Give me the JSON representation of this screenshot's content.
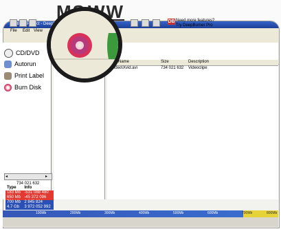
{
  "header": {
    "word_left": "MS",
    "word_right": "WW"
  },
  "window": {
    "title": "Untitled Project - DeepBurner",
    "menu": [
      "File",
      "Edit",
      "View"
    ]
  },
  "promo": {
    "line1": "Need more features?",
    "line2": "Try DeepBurner Pro"
  },
  "nav": {
    "items": [
      {
        "label": "CD/DVD",
        "icon": "disc-icon"
      },
      {
        "label": "Autorun",
        "icon": "calendar-icon"
      },
      {
        "label": "Print Label",
        "icon": "printer-icon"
      },
      {
        "label": "Burn Disk",
        "icon": "burn-disk-icon"
      }
    ]
  },
  "info": {
    "total_size": "734 021 632",
    "headers": [
      "Type",
      "Info"
    ],
    "rows": [
      {
        "type": "183 Mb",
        "info": "-531 088 480",
        "color": "#e23a30"
      },
      {
        "type": "650 Mb",
        "info": "-45 372 096",
        "color": "#e23a30"
      },
      {
        "type": "700 Mb",
        "info": "2 845 824",
        "color": "#2a4fb5"
      },
      {
        "type": "4.7 Gb",
        "info": "3 972 052 992",
        "color": "#2a4fb5"
      }
    ]
  },
  "list": {
    "columns": [
      "Name",
      "Size",
      "Description"
    ],
    "rows": [
      {
        "name": "Video\\Xvid.avi",
        "size": "734 021 632",
        "description": "Videoclipe"
      }
    ]
  },
  "capacity": {
    "ticks": [
      "100Mb",
      "200Mb",
      "300Mb",
      "400Mb",
      "500Mb",
      "600Mb",
      "700Mb",
      "800Mb"
    ],
    "used_color": "#3557b8",
    "overflow_color": "#e6d33a"
  },
  "colors": {
    "accent": "#c8332f",
    "titlebar": "#1d3f97"
  }
}
